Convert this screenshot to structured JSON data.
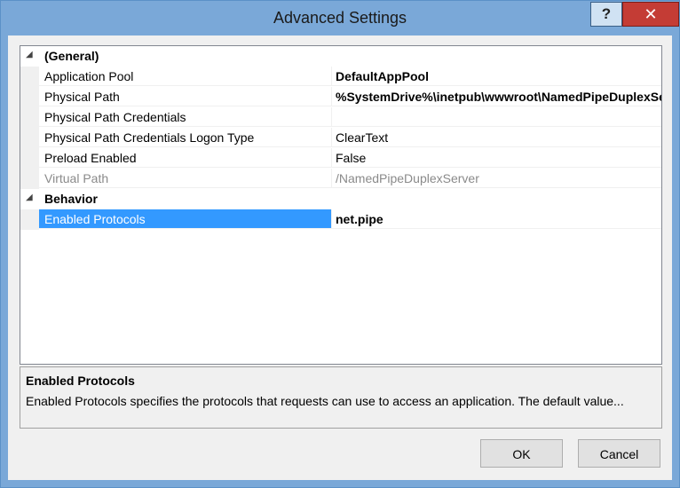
{
  "window": {
    "title": "Advanced Settings",
    "help_label": "?",
    "close_label": "✕"
  },
  "grid": {
    "categories": [
      {
        "arrow": "◢",
        "label": "(General)",
        "properties": [
          {
            "name": "Application Pool",
            "value": "DefaultAppPool",
            "value_style": "bold"
          },
          {
            "name": "Physical Path",
            "value": "%SystemDrive%\\inetpub\\wwwroot\\NamedPipeDuplexServer",
            "value_style": "bold"
          },
          {
            "name": "Physical Path Credentials",
            "value": "",
            "value_style": "normal"
          },
          {
            "name": "Physical Path Credentials Logon Type",
            "value": "ClearText",
            "value_style": "normal"
          },
          {
            "name": "Preload Enabled",
            "value": "False",
            "value_style": "normal"
          },
          {
            "name": "Virtual Path",
            "value": "/NamedPipeDuplexServer",
            "value_style": "gray"
          }
        ]
      },
      {
        "arrow": "◢",
        "label": "Behavior",
        "properties": [
          {
            "name": "Enabled Protocols",
            "value": "net.pipe",
            "value_style": "bold",
            "selected": true
          }
        ]
      }
    ]
  },
  "description": {
    "title": "Enabled Protocols",
    "text": "Enabled Protocols specifies the protocols that requests can use to access an application. The default value..."
  },
  "buttons": {
    "ok": "OK",
    "cancel": "Cancel"
  },
  "colors": {
    "titlebar": "#7aa8d8",
    "selection": "#3399ff",
    "close_button": "#c43c35"
  }
}
